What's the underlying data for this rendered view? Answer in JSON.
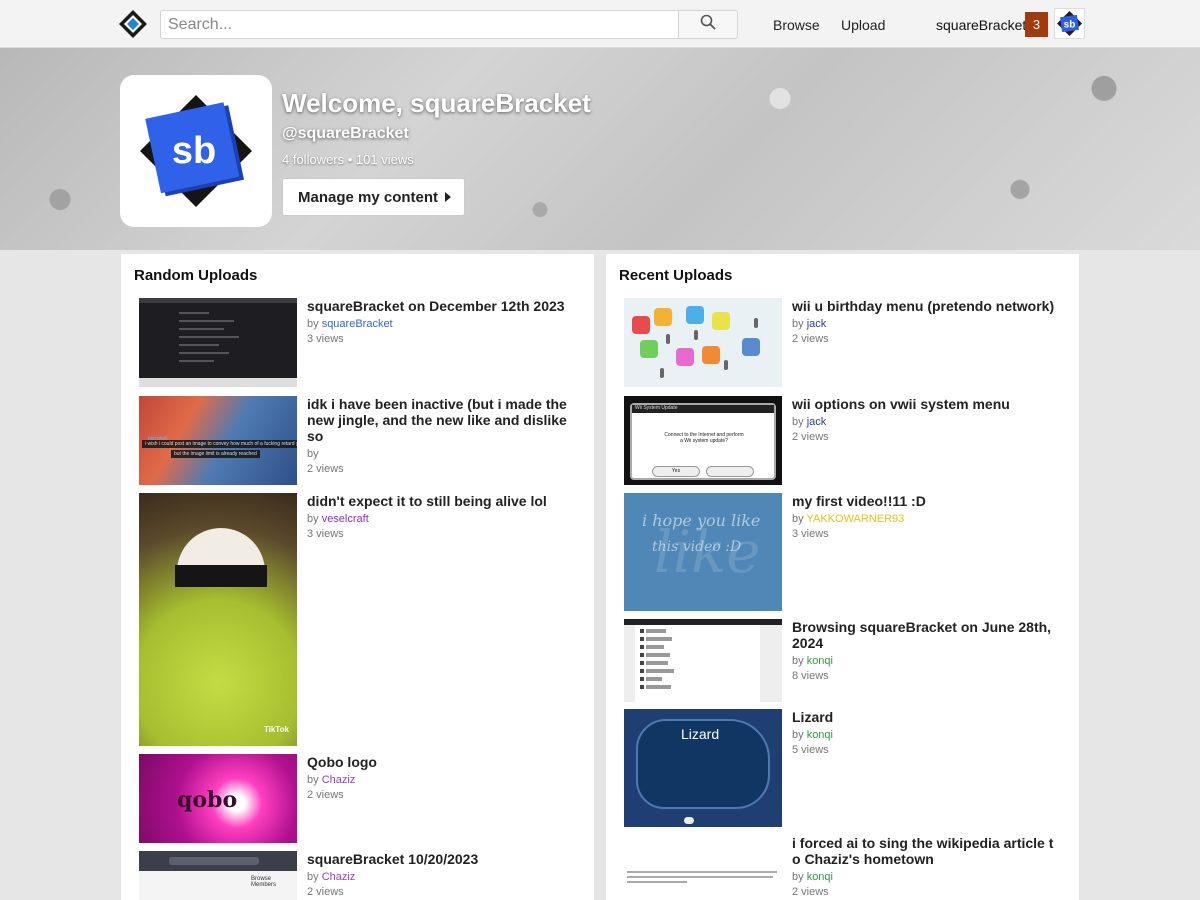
{
  "header": {
    "search_placeholder": "Search...",
    "nav": {
      "browse": "Browse",
      "upload": "Upload"
    },
    "username": "squareBracket",
    "notification_count": "3",
    "avatar_initials": "sb"
  },
  "profile": {
    "welcome": "Welcome, squareBracket",
    "handle": "@squareBracket",
    "stats": "4 followers • 101 views",
    "manage_button": "Manage my content",
    "avatar_text": "sb"
  },
  "random_uploads": {
    "title": "Random Uploads",
    "items": [
      {
        "title": "squareBracket on December 12th 2023",
        "by": "by",
        "author": "squareBracket",
        "author_color": "#3367c9",
        "views": "3 views"
      },
      {
        "title": "idk i have been inactive (but i made the new jingle, and the new like and dislike so",
        "by": "by",
        "author": "",
        "author_color": "#3367c9",
        "views": "2 views",
        "thumb_caption_1": "i wish i could post an image to convey how much of a fucking retard you are,",
        "thumb_caption_2": "but the image limit is already reached",
        "thumb_caption_user": "pizzahell"
      },
      {
        "title": "didn't expect it to still being alive lol",
        "by": "by",
        "author": "veselcraft",
        "author_color": "#8e2fc2",
        "views": "3 views",
        "thumb_overlay": "TikTok"
      },
      {
        "title": "Qobo logo",
        "by": "by",
        "author": "Chaziz",
        "author_color": "#a03bb8",
        "views": "2 views",
        "thumb_text": "qobo"
      },
      {
        "title": "squareBracket 10/20/2023",
        "by": "by",
        "author": "Chaziz",
        "author_color": "#a03bb8",
        "views": "2 views",
        "thumb_text": "Browse Members"
      }
    ]
  },
  "recent_uploads": {
    "title": "Recent Uploads",
    "items": [
      {
        "title": "wii u birthday menu (pretendo network)",
        "by": "by",
        "author": "jack",
        "author_color": "#2d3d9c",
        "views": "2 views"
      },
      {
        "title": "wii options on vwii system menu",
        "by": "by",
        "author": "jack",
        "author_color": "#2d3d9c",
        "views": "2 views",
        "thumb_header": "Wii System Update",
        "thumb_message": "Connect to the Internet and perform a Wii system update?",
        "thumb_yes": "Yes"
      },
      {
        "title": "my first video!!11 :D",
        "by": "by",
        "author": "YAKKOWARNER93",
        "author_color": "#e3c21a",
        "views": "3 views",
        "thumb_line_1": "i hope you like",
        "thumb_line_2": "this video :D",
        "thumb_big": "like"
      },
      {
        "title": "Browsing squareBracket on June 28th, 2024",
        "by": "by",
        "author": "konqi",
        "author_color": "#2f9c3e",
        "views": "8 views"
      },
      {
        "title": "Lizard",
        "by": "by",
        "author": "konqi",
        "author_color": "#2f9c3e",
        "views": "5 views",
        "thumb_text": "Lizard"
      },
      {
        "title": "i forced ai to sing the wikipedia article to Chaziz's hometown",
        "by": "by",
        "author": "konqi",
        "author_color": "#2f9c3e",
        "views": "2 views"
      }
    ]
  }
}
